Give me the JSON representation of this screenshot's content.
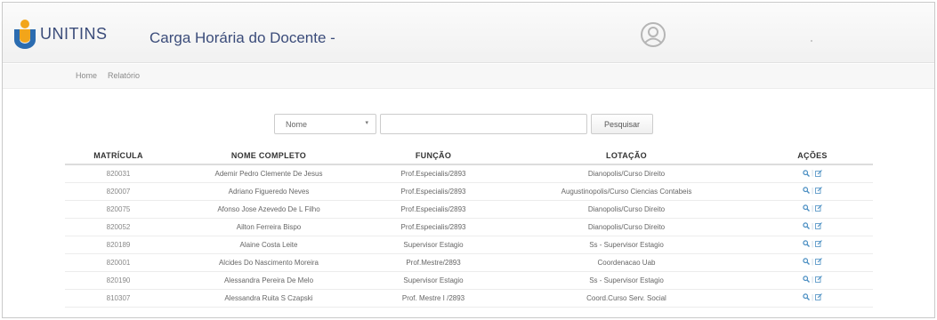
{
  "header": {
    "logo_text": "UNITINS",
    "title": "Carga Horária do Docente -"
  },
  "nav": [
    {
      "label": "Home"
    },
    {
      "label": "Relatório"
    }
  ],
  "search": {
    "select_value": "Nome",
    "input_value": "",
    "button_label": "Pesquisar"
  },
  "table": {
    "columns": [
      "MATRÍCULA",
      "NOME COMPLETO",
      "FUNÇÃO",
      "LOTAÇÃO",
      "AÇÕES"
    ],
    "rows": [
      {
        "matricula": "820031",
        "nome": "Ademir Pedro Clemente De Jesus",
        "funcao": "Prof.Especialis/2893",
        "lotacao": "Dianopolis/Curso Direito"
      },
      {
        "matricula": "820007",
        "nome": "Adriano Figueredo Neves",
        "funcao": "Prof.Especialis/2893",
        "lotacao": "Augustinopolis/Curso Ciencias Contabeis"
      },
      {
        "matricula": "820075",
        "nome": "Afonso Jose Azevedo De L Filho",
        "funcao": "Prof.Especialis/2893",
        "lotacao": "Dianopolis/Curso Direito"
      },
      {
        "matricula": "820052",
        "nome": "Ailton Ferreira Bispo",
        "funcao": "Prof.Especialis/2893",
        "lotacao": "Dianopolis/Curso Direito"
      },
      {
        "matricula": "820189",
        "nome": "Alaine Costa Leite",
        "funcao": "Supervisor Estagio",
        "lotacao": "Ss - Supervisor Estagio"
      },
      {
        "matricula": "820001",
        "nome": "Alcides Do Nascimento Moreira",
        "funcao": "Prof.Mestre/2893",
        "lotacao": "Coordenacao Uab"
      },
      {
        "matricula": "820190",
        "nome": "Alessandra Pereira De Melo",
        "funcao": "Supervisor Estagio",
        "lotacao": "Ss - Supervisor Estagio"
      },
      {
        "matricula": "810307",
        "nome": "Alessandra Ruita S Czapski",
        "funcao": "Prof. Mestre I /2893",
        "lotacao": "Coord.Curso Serv. Social"
      }
    ],
    "action_separator": "|"
  },
  "colors": {
    "brand": "#3b4c7a",
    "action": "#4a8ec2",
    "logo_orange": "#f2a51a",
    "logo_blue": "#2b6cb0"
  }
}
